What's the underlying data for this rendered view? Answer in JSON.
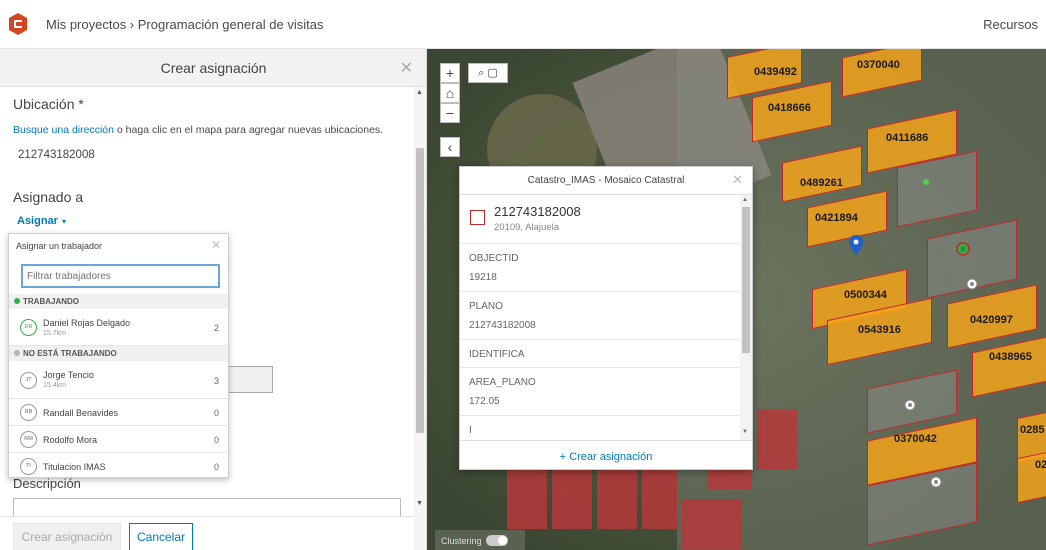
{
  "header": {
    "breadcrumb": "Mis proyectos › Programación general de visitas",
    "resources": "Recursos"
  },
  "panel": {
    "title": "Crear asignación",
    "close": "✕",
    "location_label": "Ubicación *",
    "hint_link": "Busque una dirección",
    "hint_rest": " o haga clic en el mapa para agregar nuevas ubicaciones.",
    "location_value": "212743182008",
    "assigned_label": "Asignado a",
    "assign_link": "Asignar",
    "assign_caret": "▾",
    "description_label": "Descripción",
    "create_button": "Crear asignación",
    "cancel_button": "Cancelar"
  },
  "worker_dropdown": {
    "title": "Asignar un trabajador",
    "close": "✕",
    "filter_placeholder": "Filtrar trabajadores",
    "section_working": "TRABAJANDO",
    "section_not_working": "NO ESTÁ TRABAJANDO",
    "status_colors": {
      "working": "#35ac46",
      "not_working": "#b5b5b5"
    },
    "working": [
      {
        "initials": "DR",
        "name": "Daniel Rojas Delgado",
        "distance": "15.7km",
        "count": "2"
      }
    ],
    "not_working": [
      {
        "initials": "JT",
        "name": "Jorge Tencio",
        "distance": "15.4km",
        "count": "3"
      },
      {
        "initials": "RB",
        "name": "Randall Benavides",
        "distance": "",
        "count": "0"
      },
      {
        "initials": "RM",
        "name": "Rodolfo Mora",
        "distance": "",
        "count": "0"
      },
      {
        "initials": "TI",
        "name": "Titulacion IMAS",
        "distance": "",
        "count": "0"
      }
    ]
  },
  "map": {
    "zoom_in": "+",
    "zoom_out": "−",
    "collapse": "‹",
    "clustering_label": "Clustering",
    "parcel_labels": [
      "0439492",
      "0370040",
      "0418666",
      "0411686",
      "0489261",
      "0421894",
      "0500344",
      "0543916",
      "0420997",
      "0438965",
      "0370042",
      "0285",
      "02"
    ],
    "parcel_color": "#f2a31b",
    "parcel_border": "#c2262b"
  },
  "popup": {
    "title": "Catastro_IMAS - Mosaico Catastral",
    "close": "✕",
    "feature_id": "212743182008",
    "feature_sub": "20109, Alajuela",
    "fields": [
      {
        "key": "OBJECTID",
        "value": "19218"
      },
      {
        "key": "PLANO",
        "value": "212743182008"
      },
      {
        "key": "IDENTIFICA",
        "value": ""
      },
      {
        "key": "AREA_PLANO",
        "value": "172.05"
      },
      {
        "key": "I",
        "value": ""
      }
    ],
    "action": "+ Crear asignación"
  }
}
